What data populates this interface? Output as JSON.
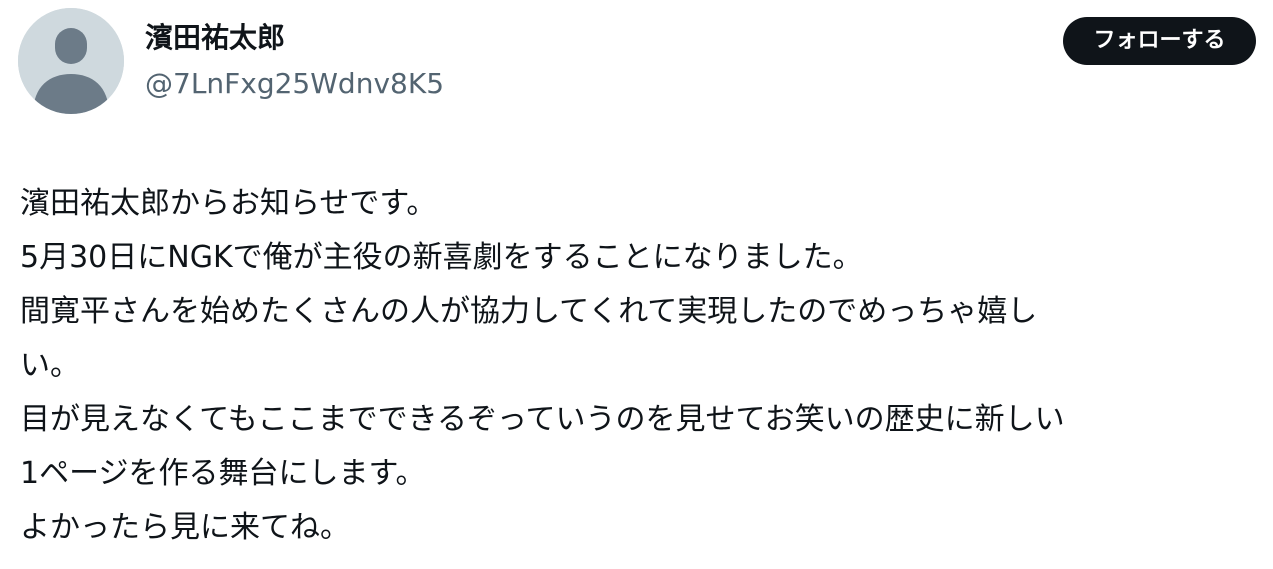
{
  "author": {
    "display_name": "濱田祐太郎",
    "handle": "@7LnFxg25Wdnv8K5",
    "avatar_icon": "default-avatar-icon"
  },
  "follow_button": {
    "label": "フォローする"
  },
  "tweet": {
    "lines": [
      "濱田祐太郎からお知らせです。",
      "5月30日にNGKで俺が主役の新喜劇をすることになりました。",
      "間寛平さんを始めたくさんの人が協力してくれて実現したのでめっちゃ嬉し",
      "い。",
      "目が見えなくてもここまでできるぞっていうのを見せてお笑いの歴史に新しい",
      "1ページを作る舞台にします。",
      "よかったら見に来てね。"
    ]
  },
  "colors": {
    "text": "#0f1419",
    "secondary_text": "#536471",
    "avatar_bg": "#cfd9de",
    "avatar_fg": "#6c7b88",
    "button_bg": "#0f1419",
    "button_text": "#ffffff"
  }
}
